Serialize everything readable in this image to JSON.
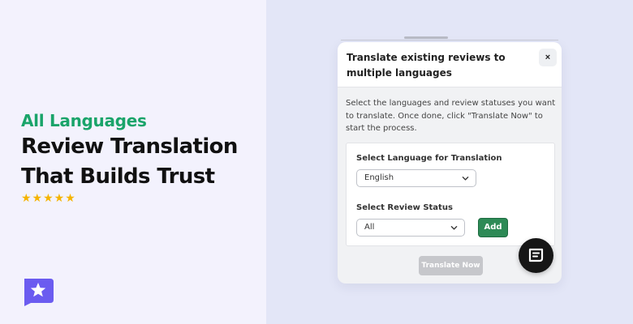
{
  "hero": {
    "eyebrow": "All Languages",
    "headline_line1": "Review Translation",
    "headline_line2": "That Builds Trust",
    "rating_stars": "★★★★★",
    "rating_value": 5
  },
  "modal": {
    "title": "Translate existing reviews to multiple languages",
    "close_label": "×",
    "description": "Select the languages and review statuses you want to translate. Once done, click \"Translate Now\" to start the process.",
    "language_label": "Select Language for Translation",
    "language_value": "English",
    "status_label": "Select Review Status",
    "status_value": "All",
    "add_label": "Add",
    "translate_label": "Translate Now"
  },
  "icons": {
    "brand": "star-badge-icon",
    "chevron": "chevron-down-icon",
    "chat": "chat-icon"
  },
  "colors": {
    "accent_green": "#1aa46a",
    "button_green": "#2d8a56",
    "brand_purple": "#6b5cf0",
    "star_gold": "#f5b400",
    "disabled_gray": "#c6c7cb"
  }
}
